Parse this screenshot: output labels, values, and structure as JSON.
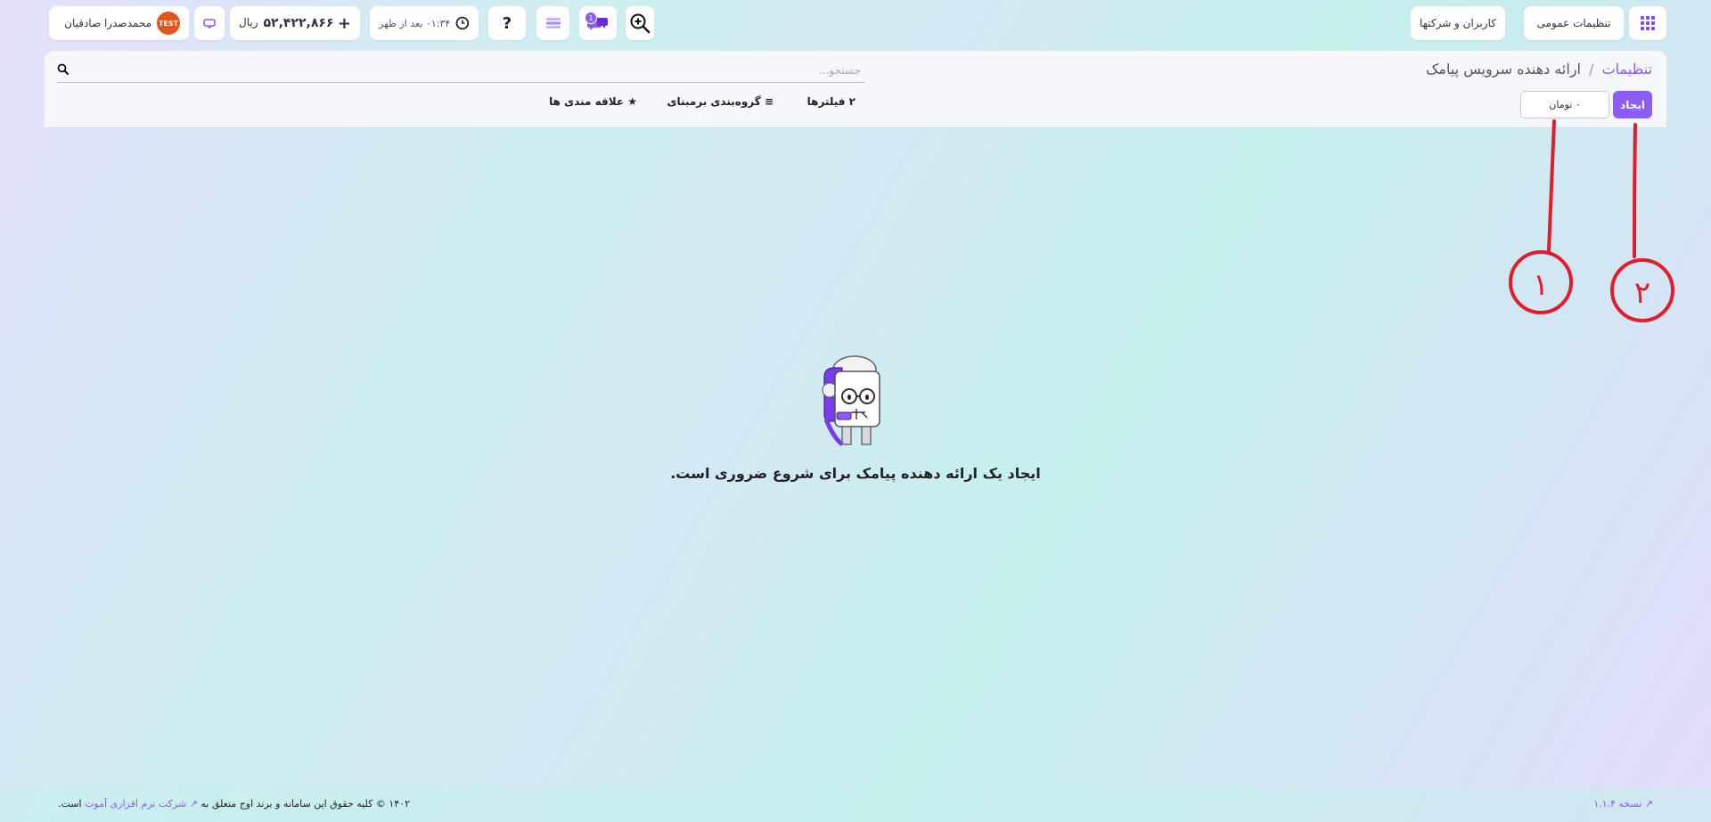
{
  "topbar": {
    "apps_icon": "grid-icon",
    "general_settings": "تنظیمات عمومی",
    "users_companies": "کاربران و شرکتها",
    "zoom_icon": "zoom-in-icon",
    "chat_badge": "1",
    "time": "۰۱:۳۴ بعد از ظهر",
    "balance_plus": "+",
    "balance_amount": "۵۲,۴۲۲,۸۶۶",
    "balance_currency": "ریال",
    "user_name": "محمدصدرا صادقیان",
    "user_badge": "TEST",
    "accent": "#8b5cf6"
  },
  "header": {
    "breadcrumb_root": "تنظیمات",
    "breadcrumb_separator": "/",
    "title": "ارائه دهنده سرویس پیامک"
  },
  "search": {
    "placeholder": "جستجو..."
  },
  "toolbar": {
    "create_label": "ایجاد",
    "toman_label": "۰ تومان",
    "filters_label": "۲ فیلترها",
    "group_label": "گروه‌بندی برمبنای",
    "favorites_label": "علاقه مندی ها"
  },
  "empty": {
    "message": "ایجاد یک ارائه دهنده پیامک برای شروع ضروری است."
  },
  "annotations": {
    "marker_1": "۱",
    "marker_2": "۲"
  },
  "footer": {
    "copyright_prefix": "۱۴۰۲ © کلیه حقوق این سامانه و برند اوج متعلق به",
    "company_link": "شرکت نرم افزاری آموت",
    "copyright_suffix": "است.",
    "version": "نسخه ۱.۱.۴"
  }
}
